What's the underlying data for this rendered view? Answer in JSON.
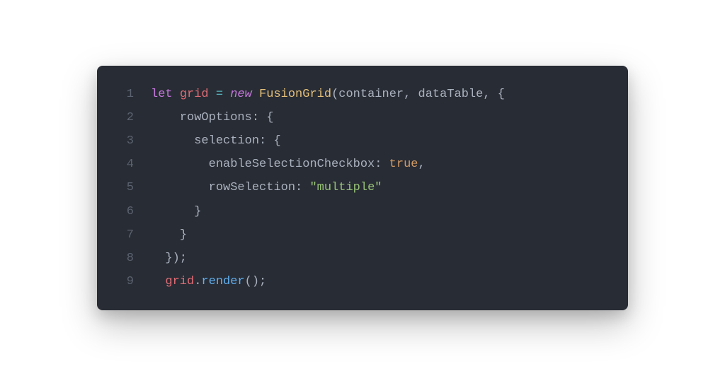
{
  "code": {
    "lines": [
      {
        "num": "1",
        "indent": "",
        "tokens": [
          {
            "cls": "tok-keyword",
            "text": "let"
          },
          {
            "cls": "tok-punct",
            "text": " "
          },
          {
            "cls": "tok-variable",
            "text": "grid"
          },
          {
            "cls": "tok-punct",
            "text": " "
          },
          {
            "cls": "tok-operator",
            "text": "="
          },
          {
            "cls": "tok-punct",
            "text": " "
          },
          {
            "cls": "tok-keyword-new",
            "text": "new"
          },
          {
            "cls": "tok-punct",
            "text": " "
          },
          {
            "cls": "tok-class",
            "text": "FusionGrid"
          },
          {
            "cls": "tok-punct",
            "text": "("
          },
          {
            "cls": "tok-param",
            "text": "container"
          },
          {
            "cls": "tok-punct",
            "text": ", "
          },
          {
            "cls": "tok-param",
            "text": "dataTable"
          },
          {
            "cls": "tok-punct",
            "text": ", {"
          }
        ]
      },
      {
        "num": "2",
        "indent": "    ",
        "tokens": [
          {
            "cls": "tok-property",
            "text": "rowOptions"
          },
          {
            "cls": "tok-punct",
            "text": ": {"
          }
        ]
      },
      {
        "num": "3",
        "indent": "      ",
        "tokens": [
          {
            "cls": "tok-property",
            "text": "selection"
          },
          {
            "cls": "tok-punct",
            "text": ": {"
          }
        ]
      },
      {
        "num": "4",
        "indent": "        ",
        "tokens": [
          {
            "cls": "tok-property",
            "text": "enableSelectionCheckbox"
          },
          {
            "cls": "tok-punct",
            "text": ": "
          },
          {
            "cls": "tok-boolean",
            "text": "true"
          },
          {
            "cls": "tok-punct",
            "text": ","
          }
        ]
      },
      {
        "num": "5",
        "indent": "        ",
        "tokens": [
          {
            "cls": "tok-property",
            "text": "rowSelection"
          },
          {
            "cls": "tok-punct",
            "text": ": "
          },
          {
            "cls": "tok-string",
            "text": "\"multiple\""
          }
        ]
      },
      {
        "num": "6",
        "indent": "      ",
        "tokens": [
          {
            "cls": "tok-punct",
            "text": "}"
          }
        ]
      },
      {
        "num": "7",
        "indent": "    ",
        "tokens": [
          {
            "cls": "tok-punct",
            "text": "}"
          }
        ]
      },
      {
        "num": "8",
        "indent": "  ",
        "tokens": [
          {
            "cls": "tok-punct",
            "text": "});"
          }
        ]
      },
      {
        "num": "9",
        "indent": "  ",
        "tokens": [
          {
            "cls": "tok-variable",
            "text": "grid"
          },
          {
            "cls": "tok-punct",
            "text": "."
          },
          {
            "cls": "tok-function",
            "text": "render"
          },
          {
            "cls": "tok-punct",
            "text": "();"
          }
        ]
      }
    ]
  }
}
